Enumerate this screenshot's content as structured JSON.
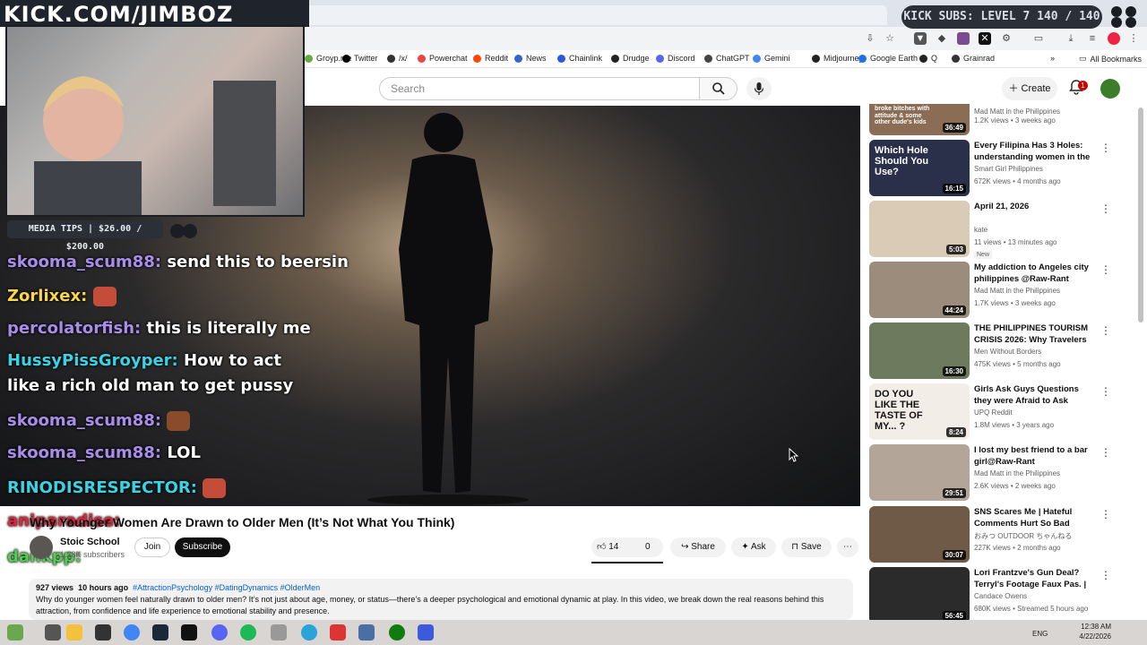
{
  "overlay": {
    "kick_banner": "KICK.COM/JIMBOZ",
    "subs_badge": "KICK SUBS: LEVEL 7 140 / 140",
    "tips_badge": "MEDIA TIPS | $26.00 / $200.00"
  },
  "bookmarks": [
    {
      "label": "Groyp.me",
      "color": "#6a4"
    },
    {
      "label": "Twitter",
      "color": "#000"
    },
    {
      "label": "/x/",
      "color": "#333"
    },
    {
      "label": "Powerchat",
      "color": "#e44"
    },
    {
      "label": "Reddit",
      "color": "#ff4500"
    },
    {
      "label": "News",
      "color": "#36c"
    },
    {
      "label": "Chainlink",
      "color": "#2a5ada"
    },
    {
      "label": "Drudge",
      "color": "#222"
    },
    {
      "label": "Discord",
      "color": "#5865f2"
    },
    {
      "label": "ChatGPT",
      "color": "#444"
    },
    {
      "label": "Gemini",
      "color": "#4285f4"
    },
    {
      "label": "Midjourney",
      "color": "#222"
    },
    {
      "label": "Google Earth",
      "color": "#1a73e8"
    },
    {
      "label": "Q",
      "color": "#222"
    },
    {
      "label": "Grainrad",
      "color": "#333"
    }
  ],
  "bookmarks_all": "All Bookmarks",
  "header": {
    "search_placeholder": "Search",
    "create_label": "Create",
    "notifications": "1"
  },
  "chat": [
    {
      "user": "skooma_scum88:",
      "msg": "send this to beersin",
      "cls": ""
    },
    {
      "user": "Zorlixex:",
      "msg": "",
      "cls": "g"
    },
    {
      "user": "percolatorfish:",
      "msg": "this is literally me",
      "cls": ""
    },
    {
      "user": "HussyPissGroyper:",
      "msg": "How to act",
      "cls": "c"
    },
    {
      "user": "",
      "msg": "like a rich old man to get pussy",
      "cls": ""
    },
    {
      "user": "skooma_scum88:",
      "msg": "",
      "cls": ""
    },
    {
      "user": "skooma_scum88:",
      "msg": "LOL",
      "cls": ""
    },
    {
      "user": "RINODISRESPECTOR:",
      "msg": "",
      "cls": "c"
    },
    {
      "user": "aniparadise:",
      "msg": "",
      "cls": "r"
    },
    {
      "user": "dankpp:",
      "msg": "",
      "cls": "gr"
    }
  ],
  "video": {
    "title": "Why Younger Women Are Drawn to Older Men (It’s Not What You Think)",
    "channel": "Stoic School",
    "subs": "1.28K subscribers",
    "join": "Join",
    "subscribe": "Subscribe",
    "likes": "14",
    "dislikes": "0",
    "share": "Share",
    "ask": "Ask",
    "save": "Save",
    "views": "927 views",
    "age": "10 hours ago",
    "tags": "#AttractionPsychology #DatingDynamics #OlderMen",
    "description": "Why do younger women feel naturally drawn to older men? It’s not just about age, money, or status—there’s a deeper psychological and emotional dynamic at play. In this video, we break down the real reasons behind this attraction, from confidence and life experience to emotional stability and presence."
  },
  "sidebar": [
    {
      "title": "",
      "channel": "Mad Matt in the Philippines",
      "meta": "1.2K views • 3 weeks ago",
      "dur": "36:49",
      "thumb": "#8b6d55",
      "caption": "broke bitches with attitude & some other dude's kids"
    },
    {
      "title": "Every Filipina Has 3 Holes: understanding women in the ...",
      "channel": "Smart Girl Philippines",
      "meta": "672K views • 4 months ago",
      "dur": "16:15",
      "thumb": "#2a2f4a",
      "caption": "Which Hole Should You Use?"
    },
    {
      "title": "April 21, 2026",
      "channel": "kate",
      "meta": "11 views • 13 minutes ago",
      "dur": "5:03",
      "thumb": "#d9cbb5",
      "badge": "New",
      "caption": ""
    },
    {
      "title": "My addiction to Angeles city philippines @Raw-Rant",
      "channel": "Mad Matt in the Philippines",
      "meta": "1.7K views • 3 weeks ago",
      "dur": "44:24",
      "thumb": "#9b8c7b",
      "caption": ""
    },
    {
      "title": "THE PHILIPPINES TOURISM CRISIS 2026: Why Travelers ...",
      "channel": "Men Without Borders",
      "meta": "475K views • 5 months ago",
      "dur": "16:30",
      "thumb": "#6d7a5d",
      "caption": ""
    },
    {
      "title": "Girls Ask Guys Questions they were Afraid to Ask",
      "channel": "UPQ Reddit",
      "meta": "1.8M views • 3 years ago",
      "dur": "8:24",
      "thumb": "#f2ede6",
      "caption": "DO YOU LIKE THE TASTE OF MY... ?"
    },
    {
      "title": "I lost my best friend to a bar girl@Raw-Rant",
      "channel": "Mad Matt in the Philippines",
      "meta": "2.6K views • 2 weeks ago",
      "dur": "29:51",
      "thumb": "#b3a597",
      "caption": ""
    },
    {
      "title": "SNS Scares Me | Hateful Comments Hurt So Bad [Solo...",
      "channel": "おみつ OUTDOOR ちゃんねる",
      "meta": "227K views • 2 months ago",
      "dur": "30:07",
      "thumb": "#6f5a48",
      "caption": ""
    },
    {
      "title": "Lori Frantzve's Gun Deal? Terryl's Footage Faux Pas. | ...",
      "channel": "Candace Owens",
      "meta": "680K views • Streamed 5 hours ago",
      "dur": "56:45",
      "thumb": "#2b2b2b",
      "caption": ""
    }
  ],
  "tray": {
    "lang": "ENG",
    "time": "12:38 AM",
    "date": "4/22/2026"
  }
}
